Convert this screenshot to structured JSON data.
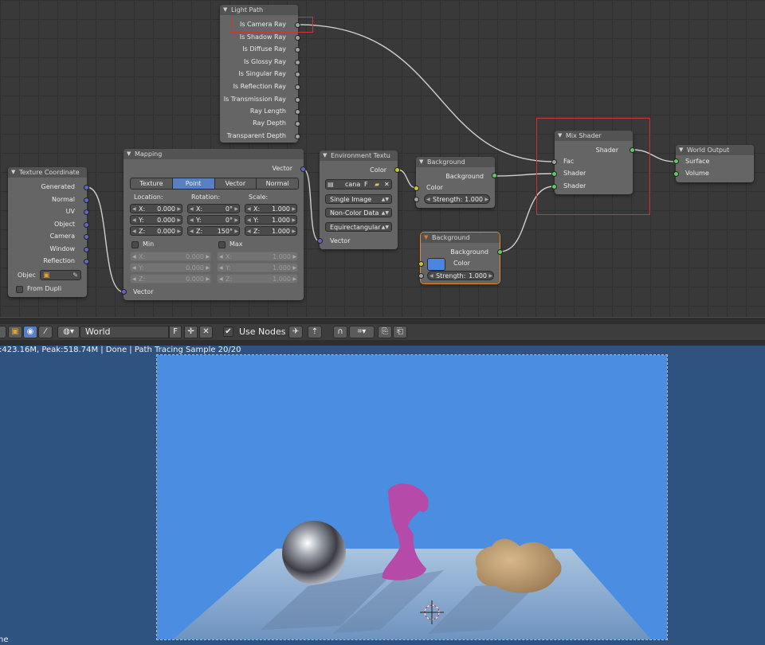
{
  "node_editor": {
    "nodes": {
      "light_path": {
        "title": "Light Path",
        "outputs": [
          "Is Camera Ray",
          "Is Shadow Ray",
          "Is Diffuse Ray",
          "Is Glossy Ray",
          "Is Singular Ray",
          "Is Reflection Ray",
          "Is Transmission Ray",
          "Ray Length",
          "Ray Depth",
          "Transparent Depth"
        ]
      },
      "texture_coordinate": {
        "title": "Texture Coordinate",
        "outputs": [
          "Generated",
          "Normal",
          "UV",
          "Object",
          "Camera",
          "Window",
          "Reflection"
        ],
        "object_label": "Objec",
        "from_dupli": "From Dupli"
      },
      "mapping": {
        "title": "Mapping",
        "output": "Vector",
        "tabs": [
          "Texture",
          "Point",
          "Vector",
          "Normal"
        ],
        "active_tab": "Point",
        "location_label": "Location:",
        "rotation_label": "Rotation:",
        "scale_label": "Scale:",
        "location": [
          {
            "axis": "X:",
            "value": "0.000"
          },
          {
            "axis": "Y:",
            "value": "0.000"
          },
          {
            "axis": "Z:",
            "value": "0.000"
          }
        ],
        "rotation": [
          {
            "axis": "X:",
            "value": "0°"
          },
          {
            "axis": "Y:",
            "value": "0°"
          },
          {
            "axis": "Z:",
            "value": "150°"
          }
        ],
        "scale": [
          {
            "axis": "X:",
            "value": "1.000"
          },
          {
            "axis": "Y:",
            "value": "1.000"
          },
          {
            "axis": "Z:",
            "value": "1.000"
          }
        ],
        "min_label": "Min",
        "max_label": "Max",
        "min_values": [
          {
            "axis": "X:",
            "value": "0.000"
          },
          {
            "axis": "Y:",
            "value": "0.000"
          },
          {
            "axis": "Z:",
            "value": "0.000"
          }
        ],
        "max_values": [
          {
            "axis": "X:",
            "value": "1.000"
          },
          {
            "axis": "Y:",
            "value": "1.000"
          },
          {
            "axis": "Z:",
            "value": "1.000"
          }
        ],
        "input": "Vector"
      },
      "environment_texture": {
        "title": "Environment Textu",
        "output": "Color",
        "image_name": "cana",
        "fake_user": "F",
        "projection_source": "Single Image",
        "color_space": "Non-Color Data",
        "projection": "Equirectangular",
        "input": "Vector"
      },
      "background_1": {
        "title": "Background",
        "output": "Background",
        "input_color": "Color",
        "strength_label": "Strength:",
        "strength": "1.000"
      },
      "background_2": {
        "title": "Background",
        "output": "Background",
        "input_color": "Color",
        "strength_label": "Strength:",
        "strength": "1.000",
        "swatch_color": "#4a86e0"
      },
      "mix_shader": {
        "title": "Mix Shader",
        "output": "Shader",
        "inputs": [
          "Fac",
          "Shader",
          "Shader"
        ]
      },
      "world_output": {
        "title": "World Output",
        "inputs": [
          "Surface",
          "Volume"
        ]
      }
    }
  },
  "header": {
    "world_name": "World",
    "fake_user": "F",
    "use_nodes_label": "Use Nodes",
    "use_nodes_checked": "✔"
  },
  "image_editor": {
    "status": ":423.16M, Peak:518.74M | Done | Path Tracing Sample 20/20",
    "bottom_label": "ne",
    "render_background": "#4b8de0"
  },
  "colors": {
    "accent": "#5680c2",
    "selection": "#d03535",
    "socket_gray": "#a1a1a1",
    "socket_purple": "#6363c7",
    "socket_yellow": "#c7c729",
    "socket_green": "#63c763"
  }
}
